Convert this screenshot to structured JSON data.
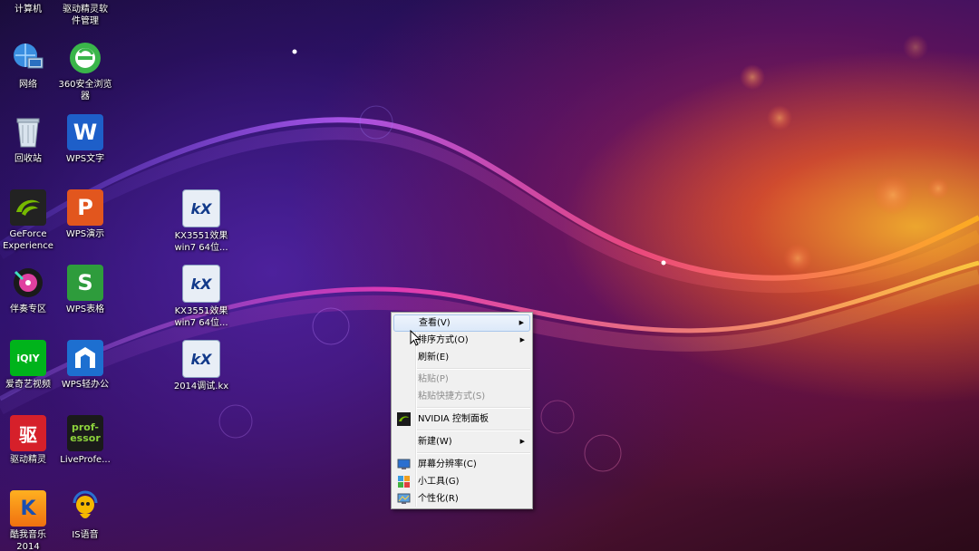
{
  "desktop": {
    "top_labels": [
      "计算机",
      "驱动精灵软\n件管理"
    ],
    "icons": [
      {
        "id": "network",
        "label": "网络"
      },
      {
        "id": "browser360",
        "label": "360安全浏览\n器"
      },
      {
        "id": "recycle",
        "label": "回收站"
      },
      {
        "id": "wps-writer",
        "label": "WPS文字"
      },
      {
        "id": "geforce",
        "label": "GeForce\nExperience"
      },
      {
        "id": "wps-present",
        "label": "WPS演示"
      },
      {
        "id": "kx1",
        "label": "KX3551效果\nwin7 64位..."
      },
      {
        "id": "music-zone",
        "label": "伴奏专区"
      },
      {
        "id": "wps-sheet",
        "label": "WPS表格"
      },
      {
        "id": "kx2",
        "label": "KX3551效果\nwin7 64位..."
      },
      {
        "id": "iqiyi",
        "label": "爱奇艺视频"
      },
      {
        "id": "wps-office",
        "label": "WPS轻办公"
      },
      {
        "id": "kx3",
        "label": "2014调试.kx"
      },
      {
        "id": "driver-genius",
        "label": "驱动精灵"
      },
      {
        "id": "liveprofessor",
        "label": "LiveProfe..."
      },
      {
        "id": "kuwo",
        "label": "酷我音乐\n2014"
      },
      {
        "id": "is-voice",
        "label": "IS语音"
      }
    ],
    "glyphs": {
      "wps_w": "W",
      "wps_p": "P",
      "wps_s": "S",
      "iqiyi": "iQIY",
      "driver": "驱",
      "prof": "prof-\nessor",
      "kx": "kX",
      "kuwo": "K"
    }
  },
  "context_menu": {
    "items": [
      {
        "label": "查看(V)",
        "submenu": true,
        "hover": true
      },
      {
        "label": "排序方式(O)",
        "submenu": true
      },
      {
        "label": "刷新(E)"
      },
      {
        "label": "粘贴(P)",
        "disabled": true
      },
      {
        "label": "粘贴快捷方式(S)",
        "disabled": true
      },
      {
        "label": "NVIDIA 控制面板",
        "icon": "nvidia-icon"
      },
      {
        "label": "新建(W)",
        "submenu": true
      },
      {
        "label": "屏幕分辨率(C)",
        "icon": "display-icon"
      },
      {
        "label": "小工具(G)",
        "icon": "gadgets-icon"
      },
      {
        "label": "个性化(R)",
        "icon": "personalize-icon"
      }
    ],
    "arrow": "▶"
  },
  "colors": {
    "menu_bg": "#f0f0f0",
    "menu_hover": "#dce9f9",
    "disabled_text": "#8d8d8d",
    "wps_blue": "#1e5fc9",
    "wps_orange": "#e2561e",
    "wps_green": "#2e9c3c",
    "iqiyi_green": "#00b31b",
    "driver_red": "#d6202a",
    "nvidia_green": "#76b900"
  }
}
